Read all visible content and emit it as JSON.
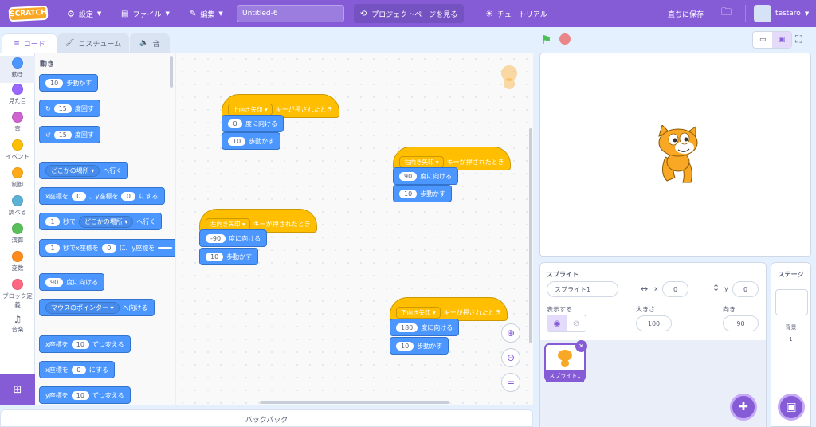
{
  "menubar": {
    "logo": "SCRATCH",
    "settings": "設定",
    "file": "ファイル",
    "edit": "編集",
    "project_title": "Untitled-6",
    "project_page": "プロジェクトページを見る",
    "tutorials": "チュートリアル",
    "save_now": "直ちに保存",
    "username": "testaro"
  },
  "tabs": {
    "code": "コード",
    "costumes": "コスチューム",
    "sounds": "音"
  },
  "categories": [
    {
      "label": "動き",
      "color": "#4c97ff"
    },
    {
      "label": "見た目",
      "color": "#9966ff"
    },
    {
      "label": "音",
      "color": "#cf63cf"
    },
    {
      "label": "イベント",
      "color": "#ffbf00"
    },
    {
      "label": "制御",
      "color": "#ffab19"
    },
    {
      "label": "調べる",
      "color": "#5cb1d6"
    },
    {
      "label": "演算",
      "color": "#59c059"
    },
    {
      "label": "変数",
      "color": "#ff8c1a"
    },
    {
      "label": "ブロック定義",
      "color": "#ff6680"
    },
    {
      "label": "音楽",
      "color": ""
    }
  ],
  "palette": {
    "heading": "動き",
    "move_steps": "10",
    "move_text": "歩動かす",
    "turn_right": "15",
    "turn_right_text": "度回す",
    "turn_left": "15",
    "turn_left_text": "度回す",
    "goto_drop": "どこかの場所",
    "goto_text": "へ行く",
    "goxy_a": "x座標を",
    "goxy_x": "0",
    "goxy_b": "、y座標を",
    "goxy_y": "0",
    "goxy_c": "にする",
    "glide_sec": "1",
    "glide_a": "秒で",
    "glide_drop": "どこかの場所",
    "glide_text": "へ行く",
    "glidexy_sec": "1",
    "glidexy_a": "秒でx座標を",
    "glidexy_x": "0",
    "glidexy_b": "に、y座標を",
    "point_dir": "90",
    "point_text": "度に向ける",
    "point_to_drop": "マウスのポインター",
    "point_to_text": "へ向ける",
    "changex_a": "x座標を",
    "changex_val": "10",
    "changex_b": "ずつ変える",
    "setx_a": "x座標を",
    "setx_val": "0",
    "setx_b": "にする",
    "changey_a": "y座標を",
    "changey_val": "10",
    "changey_b": "ずつ変える"
  },
  "scripts": [
    {
      "key": "上向き矢印",
      "hat_text": "キーが押されたとき",
      "dir": "0",
      "dir_text": "度に向ける",
      "steps": "10",
      "steps_text": "歩動かす"
    },
    {
      "key": "右向き矢印",
      "hat_text": "キーが押されたとき",
      "dir": "90",
      "dir_text": "度に向ける",
      "steps": "10",
      "steps_text": "歩動かす"
    },
    {
      "key": "左向き矢印",
      "hat_text": "キーが押されたとき",
      "dir": "-90",
      "dir_text": "度に向ける",
      "steps": "10",
      "steps_text": "歩動かす"
    },
    {
      "key": "下向き矢印",
      "hat_text": "キーが押されたとき",
      "dir": "180",
      "dir_text": "度に向ける",
      "steps": "10",
      "steps_text": "歩動かす"
    }
  ],
  "backpack": "バックパック",
  "sprite_info": {
    "label": "スプライト",
    "name": "スプライト1",
    "x_label": "x",
    "x": "0",
    "y_label": "y",
    "y": "0",
    "show_label": "表示する",
    "size_label": "大きさ",
    "size": "100",
    "direction_label": "向き",
    "direction": "90",
    "thumb_name": "スプライト1"
  },
  "stage_pane": {
    "title": "ステージ",
    "backdrops_label": "背景",
    "backdrops_count": "1"
  }
}
